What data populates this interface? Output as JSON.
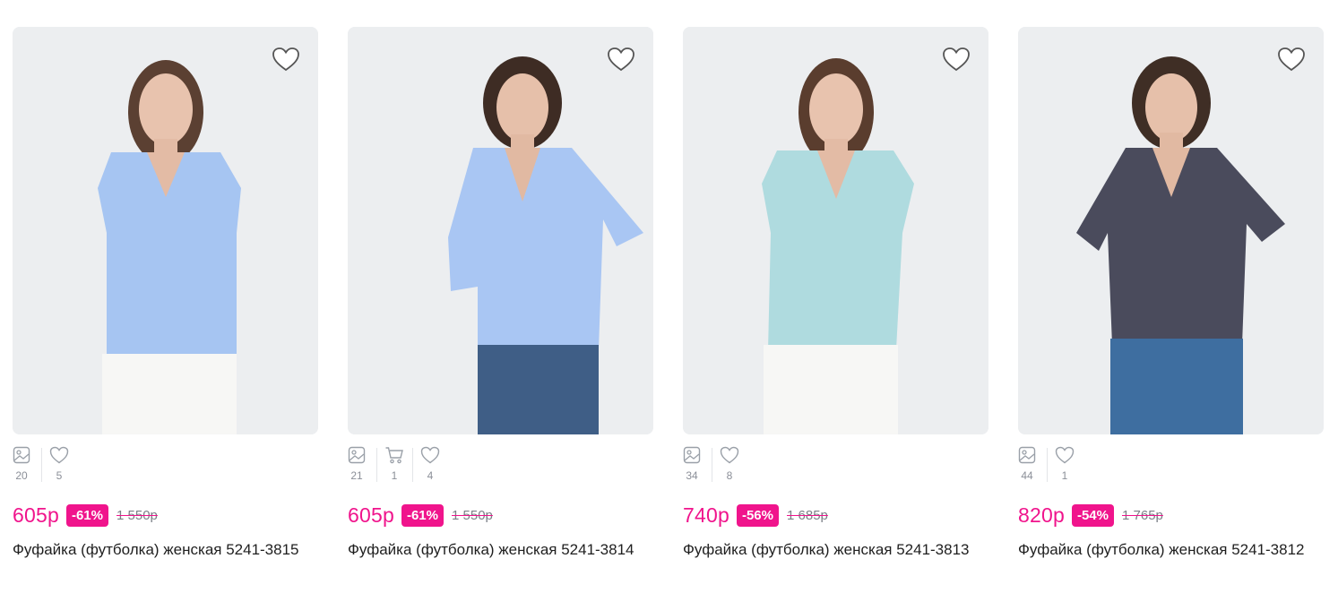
{
  "products": [
    {
      "title": "Фуфайка (футболка) женская 5241-3815",
      "price": "605р",
      "discount": "-61%",
      "old_price": "1 550р",
      "stats": [
        {
          "icon": "image-icon",
          "value": "20"
        },
        {
          "icon": "heart-outline-icon",
          "value": "5"
        }
      ],
      "shirt_color": "#a6c5f2",
      "bottom_color": "#f7f7f5"
    },
    {
      "title": "Фуфайка (футболка) женская 5241-3814",
      "price": "605р",
      "discount": "-61%",
      "old_price": "1 550р",
      "stats": [
        {
          "icon": "image-icon",
          "value": "21"
        },
        {
          "icon": "cart-icon",
          "value": "1"
        },
        {
          "icon": "heart-outline-icon",
          "value": "4"
        }
      ],
      "shirt_color": "#a9c6f3",
      "bottom_color": "#3f5e86"
    },
    {
      "title": "Фуфайка (футболка) женская 5241-3813",
      "price": "740р",
      "discount": "-56%",
      "old_price": "1 685р",
      "stats": [
        {
          "icon": "image-icon",
          "value": "34"
        },
        {
          "icon": "heart-outline-icon",
          "value": "8"
        }
      ],
      "shirt_color": "#afdbdf",
      "bottom_color": "#f7f7f5"
    },
    {
      "title": "Фуфайка (футболка) женская 5241-3812",
      "price": "820р",
      "discount": "-54%",
      "old_price": "1 765р",
      "stats": [
        {
          "icon": "image-icon",
          "value": "44"
        },
        {
          "icon": "heart-outline-icon",
          "value": "1"
        }
      ],
      "shirt_color": "#4a4b5c",
      "bottom_color": "#3e6ea0"
    }
  ],
  "colors": {
    "accent": "#f0148c",
    "muted": "#8b8f98",
    "photo_bg": "#e9ecef"
  }
}
